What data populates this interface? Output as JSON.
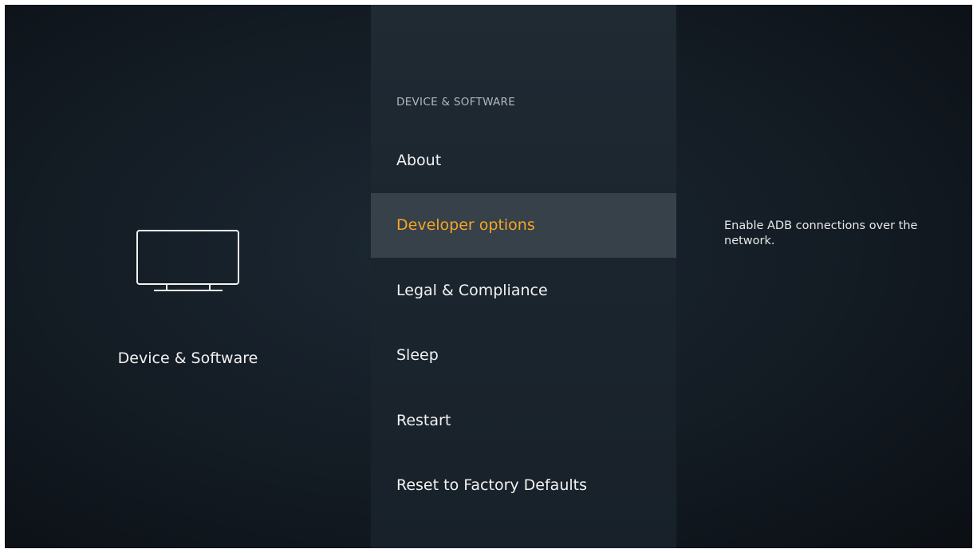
{
  "left": {
    "icon": "tv-icon",
    "label": "Device & Software"
  },
  "menu": {
    "header": "DEVICE & SOFTWARE",
    "items": [
      {
        "label": "About"
      },
      {
        "label": "Developer options",
        "selected": true
      },
      {
        "label": "Legal & Compliance"
      },
      {
        "label": "Sleep"
      },
      {
        "label": "Restart"
      },
      {
        "label": "Reset to Factory Defaults"
      }
    ]
  },
  "description": "Enable ADB connections over the network.",
  "colors": {
    "selected_text": "#f5a623",
    "selected_bg": "#36414a",
    "text": "#f2f2f2"
  }
}
